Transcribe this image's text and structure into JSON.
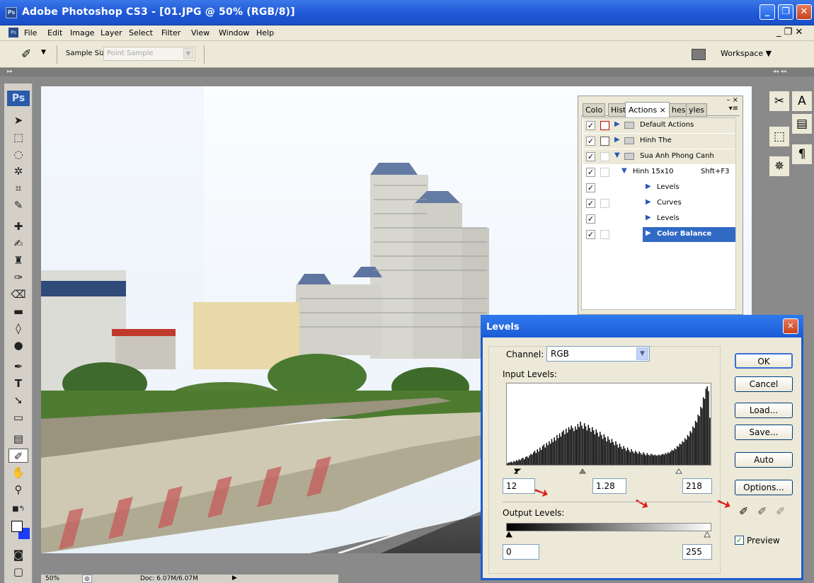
{
  "window": {
    "app_icon": "Ps",
    "title": "Adobe Photoshop CS3 - [01.JPG @ 50% (RGB/8)]"
  },
  "menu": [
    "File",
    "Edit",
    "Image",
    "Layer",
    "Select",
    "Filter",
    "View",
    "Window",
    "Help"
  ],
  "options": {
    "sample_size_label": "Sample Size:",
    "sample_size_value": "Point Sample",
    "workspace_label": "Workspace ▼"
  },
  "toolbox": {
    "logo": "Ps"
  },
  "status": {
    "zoom": "50%",
    "doc": "Doc: 6.07M/6.07M"
  },
  "actions_panel": {
    "tabs": [
      "Colo",
      "Histo",
      "Actions ×",
      "hes",
      "yles"
    ],
    "rows": [
      {
        "label": "Default Actions",
        "check": "✓"
      },
      {
        "label": "Hinh The",
        "check": "✓"
      },
      {
        "label": "Sua Anh Phong Canh",
        "check": "✓"
      },
      {
        "label": "Hinh 15x10",
        "shortcut": "Shft+F3",
        "check": "✓"
      },
      {
        "label": "Levels",
        "check": "✓"
      },
      {
        "label": "Curves",
        "check": "✓"
      },
      {
        "label": "Levels",
        "check": "✓"
      },
      {
        "label": "Color Balance",
        "check": "✓"
      }
    ]
  },
  "levels": {
    "title": "Levels",
    "channel_label": "Channel:",
    "channel_value": "RGB",
    "input_label": "Input Levels:",
    "input_black": "12",
    "input_mid": "1.28",
    "input_white": "218",
    "output_label": "Output Levels:",
    "output_black": "0",
    "output_white": "255",
    "buttons": {
      "ok": "OK",
      "cancel": "Cancel",
      "load": "Load...",
      "save": "Save...",
      "auto": "Auto",
      "options": "Options..."
    },
    "preview_label": "Preview",
    "preview_checked": true,
    "histogram": [
      2,
      3,
      3,
      4,
      3,
      5,
      4,
      6,
      5,
      7,
      6,
      8,
      9,
      7,
      10,
      11,
      9,
      12,
      14,
      13,
      16,
      18,
      15,
      20,
      17,
      22,
      19,
      24,
      26,
      22,
      28,
      25,
      30,
      27,
      33,
      29,
      35,
      31,
      38,
      34,
      40,
      36,
      42,
      44,
      39,
      46,
      41,
      48,
      45,
      50,
      47,
      43,
      49,
      45,
      52,
      48,
      55,
      50,
      46,
      53,
      49,
      44,
      51,
      47,
      42,
      48,
      44,
      39,
      45,
      41,
      36,
      42,
      38,
      33,
      39,
      35,
      30,
      36,
      32,
      28,
      33,
      29,
      25,
      30,
      26,
      22,
      27,
      23,
      20,
      24,
      21,
      18,
      22,
      19,
      16,
      20,
      17,
      15,
      18,
      16,
      14,
      17,
      15,
      13,
      16,
      14,
      12,
      15,
      13,
      12,
      14,
      13,
      12,
      13,
      12,
      12,
      13,
      12,
      13,
      14,
      13,
      15,
      14,
      16,
      15,
      17,
      19,
      18,
      21,
      20,
      24,
      23,
      27,
      26,
      30,
      29,
      34,
      32,
      38,
      36,
      43,
      41,
      49,
      47,
      56,
      54,
      64,
      62,
      74,
      72,
      86,
      84,
      97,
      100,
      94,
      60
    ]
  },
  "colors": {
    "title_blue": "#1f57d6",
    "panel_bg": "#ece9d8",
    "selection": "#316ac5",
    "arrow_red": "#e21b1b"
  }
}
